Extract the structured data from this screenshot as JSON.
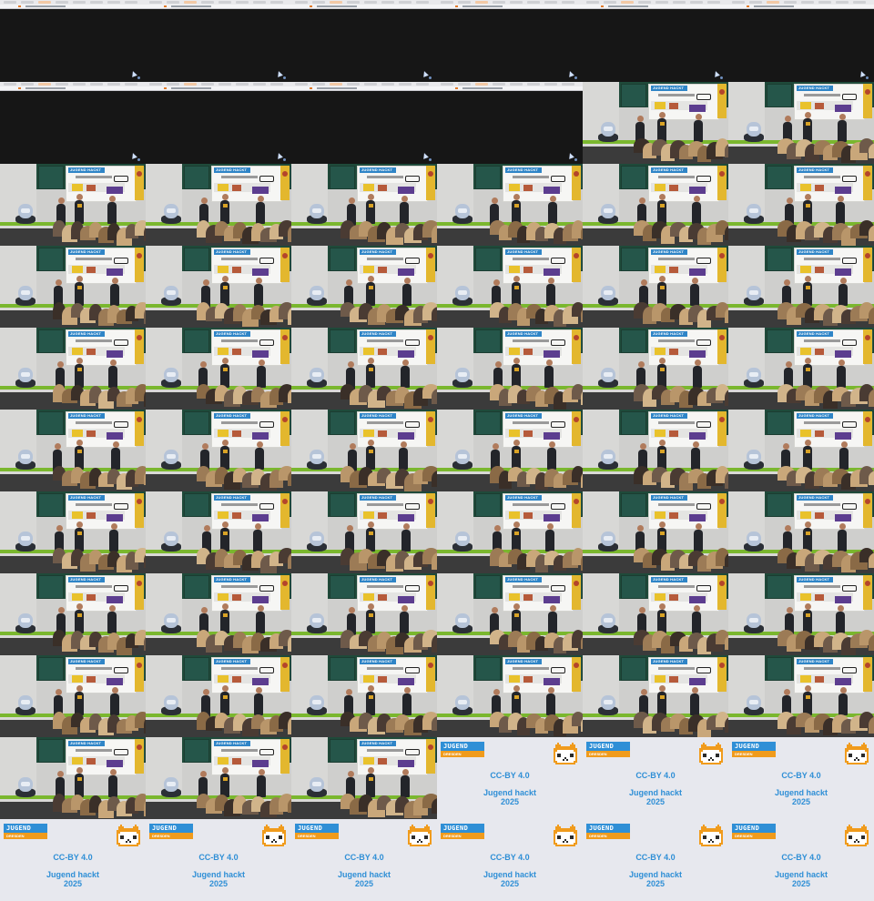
{
  "contact_sheet": {
    "columns": 6,
    "rows": 11,
    "tile_sequence": [
      "browser",
      "browser",
      "browser",
      "browser",
      "browser",
      "browser",
      "browser",
      "browser",
      "browser",
      "browser",
      "hall",
      "hall",
      "hall",
      "hall",
      "hall",
      "hall",
      "hall",
      "hall",
      "hall",
      "hall",
      "hall",
      "hall",
      "hall",
      "hall",
      "hall",
      "hall",
      "hall",
      "hall",
      "hall",
      "hall",
      "hall",
      "hall",
      "hall",
      "hall",
      "hall",
      "hall",
      "hall",
      "hall",
      "hall",
      "hall",
      "hall",
      "hall",
      "hall",
      "hall",
      "hall",
      "hall",
      "hall",
      "hall",
      "hall",
      "hall",
      "hall",
      "hall",
      "hall",
      "hall",
      "hall",
      "hall",
      "hall",
      "card",
      "card",
      "card",
      "card",
      "card",
      "card",
      "card",
      "card",
      "card"
    ]
  },
  "banner": {
    "headline": "JUGEND HACKT"
  },
  "title_card": {
    "logo_top": "JUGEND HACKT",
    "logo_bottom": "DRESDEN",
    "license": "CC-BY 4.0",
    "event_line1": "Jugend hackt",
    "event_line2": "2025"
  },
  "colors": {
    "brand_blue": "#2f8fd6",
    "brand_orange": "#f09b1c",
    "board_green": "#1f4a3a",
    "desk_green": "#7ab72e",
    "card_bg": "#e7e8ee"
  },
  "icons": {
    "mascot": "pixel-cat-icon",
    "cursor": "mouse-cursor-icon"
  }
}
